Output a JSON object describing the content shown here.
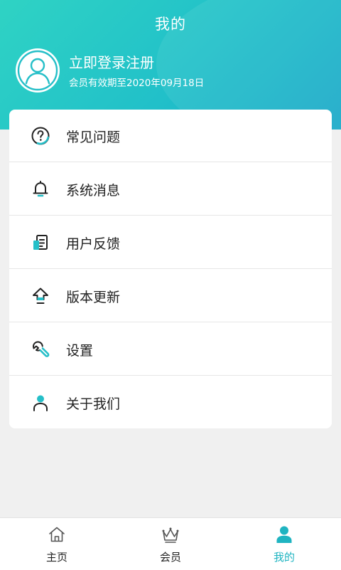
{
  "header": {
    "title": "我的",
    "login_label": "立即登录注册",
    "member_status": "会员有效期至2020年09月18日"
  },
  "menu": {
    "items": [
      {
        "label": "常见问题",
        "icon": "question-circle-icon"
      },
      {
        "label": "系统消息",
        "icon": "bell-icon"
      },
      {
        "label": "用户反馈",
        "icon": "feedback-icon"
      },
      {
        "label": "版本更新",
        "icon": "upload-arrow-icon"
      },
      {
        "label": "设置",
        "icon": "wrench-icon"
      },
      {
        "label": "关于我们",
        "icon": "person-icon"
      }
    ]
  },
  "tabbar": {
    "tabs": [
      {
        "label": "主页",
        "icon": "home-icon",
        "active": false
      },
      {
        "label": "会员",
        "icon": "crown-icon",
        "active": false
      },
      {
        "label": "我的",
        "icon": "user-icon",
        "active": true
      }
    ]
  },
  "colors": {
    "accent": "#1fb4c1",
    "header_gradient_start": "#2fd3c4",
    "header_gradient_end": "#1aa9c9"
  }
}
